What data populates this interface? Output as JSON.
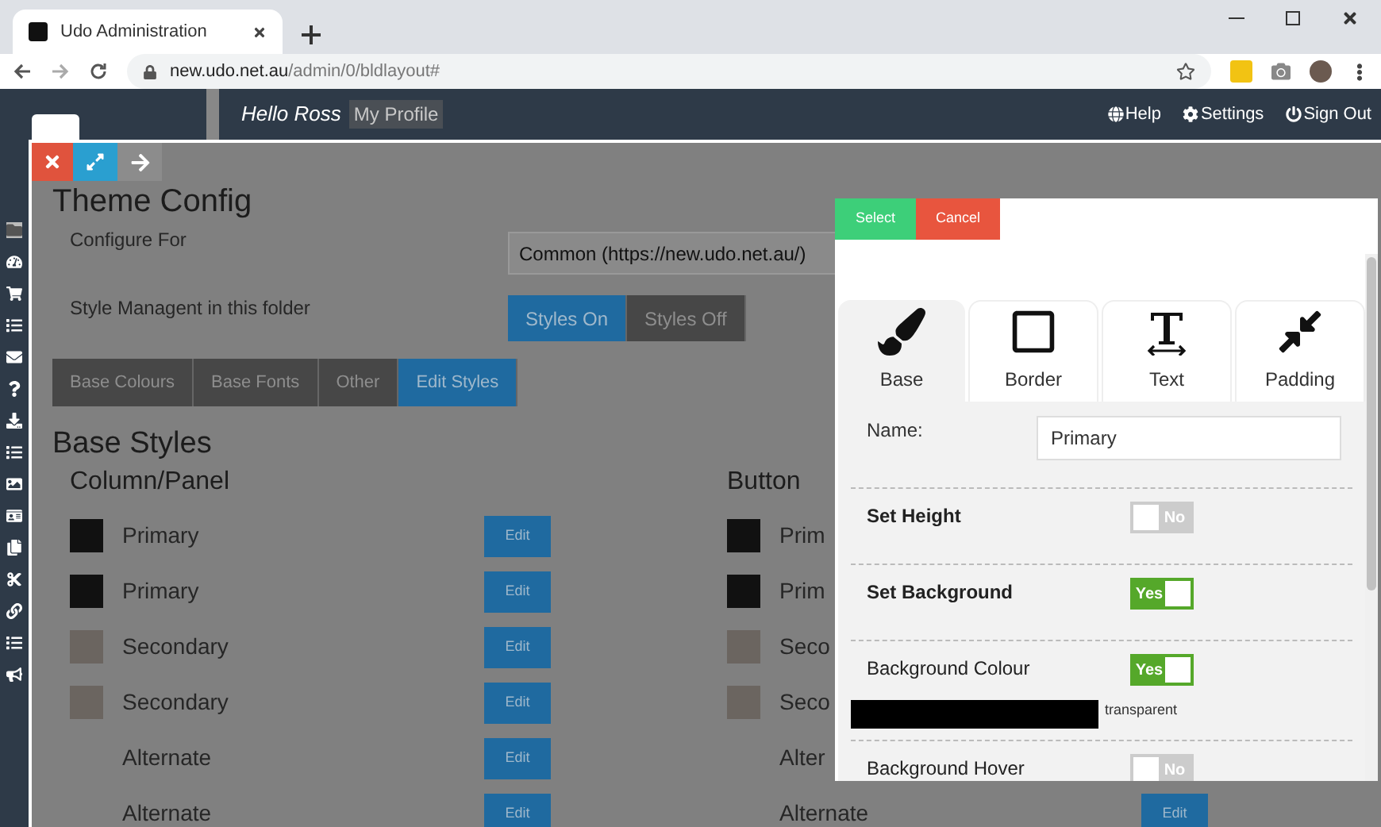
{
  "browser": {
    "tab_title": "Udo Administration",
    "url_host": "new.udo.net.au",
    "url_path": "/admin/0/bldlayout#"
  },
  "header": {
    "greeting": "Hello Ross",
    "profile_link": "My Profile",
    "links": [
      {
        "label": "Help"
      },
      {
        "label": "Settings"
      },
      {
        "label": "Sign Out"
      }
    ]
  },
  "modal": {
    "title": "Theme Config",
    "configure_for": {
      "label": "Configure For",
      "value": "Common (https://new.udo.net.au/)"
    },
    "style_management": {
      "label": "Style Managent in this folder",
      "options": [
        {
          "label": "Styles On",
          "selected": true
        },
        {
          "label": "Styles Off",
          "selected": false
        }
      ]
    },
    "tabs": [
      {
        "label": "Base Colours",
        "selected": false
      },
      {
        "label": "Base Fonts",
        "selected": false
      },
      {
        "label": "Other",
        "selected": false
      },
      {
        "label": "Edit Styles",
        "selected": true
      }
    ],
    "section_title": "Base Styles",
    "columns": [
      {
        "title": "Column/Panel",
        "rows": [
          {
            "label": "Primary",
            "color": "#111111",
            "edit": "Edit"
          },
          {
            "label": "Primary",
            "color": "#111111",
            "edit": "Edit"
          },
          {
            "label": "Secondary",
            "color": "#6b6560",
            "edit": "Edit"
          },
          {
            "label": "Secondary",
            "color": "#6b6560",
            "edit": "Edit"
          },
          {
            "label": "Alternate",
            "edit": "Edit"
          },
          {
            "label": "Alternate",
            "edit": "Edit"
          }
        ]
      },
      {
        "title": "Button",
        "rows": [
          {
            "label": "Prim",
            "color": "#111111"
          },
          {
            "label": "Prim",
            "color": "#111111"
          },
          {
            "label": "Seco",
            "color": "#6b6560"
          },
          {
            "label": "Seco",
            "color": "#6b6560"
          },
          {
            "label": "Alter"
          },
          {
            "label": "Alternate",
            "edit": "Edit"
          }
        ]
      }
    ]
  },
  "style_editor": {
    "buttons": [
      {
        "label": "Select",
        "kind": "confirm"
      },
      {
        "label": "Cancel",
        "kind": "cancel"
      }
    ],
    "tabs": [
      {
        "label": "Base",
        "selected": true
      },
      {
        "label": "Border",
        "selected": false
      },
      {
        "label": "Text",
        "selected": false
      },
      {
        "label": "Padding",
        "selected": false
      }
    ],
    "name": {
      "label": "Name:",
      "value": "Primary"
    },
    "settings": [
      {
        "label": "Set Height",
        "bold": true,
        "on": false,
        "toggle_text": "No"
      },
      {
        "label": "Set Background",
        "bold": true,
        "on": true,
        "toggle_text": "Yes"
      },
      {
        "label": "Background Colour",
        "bold": false,
        "on": true,
        "toggle_text": "Yes",
        "swatch": {
          "color": "#000000",
          "value": "transparent"
        }
      },
      {
        "label": "Background Hover",
        "bold": false,
        "on": false,
        "toggle_text": "No"
      }
    ]
  }
}
